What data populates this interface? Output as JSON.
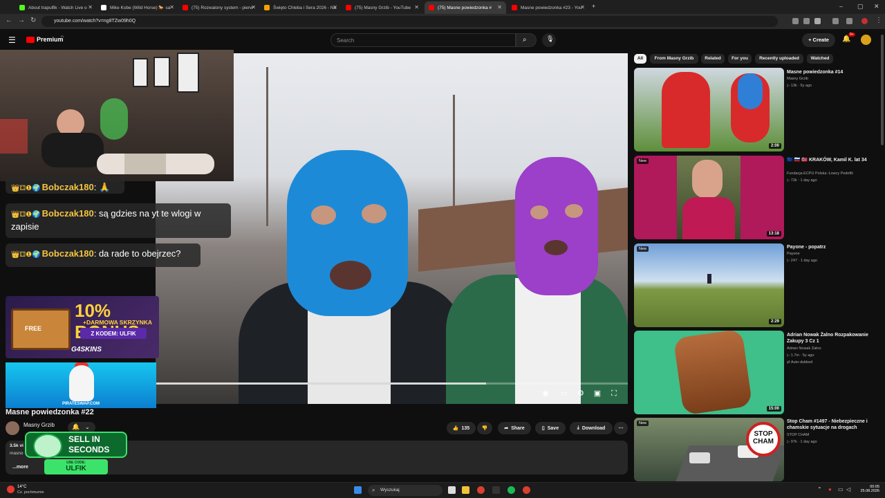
{
  "browser": {
    "tabs": [
      {
        "title": "About trapulfik - Watch Live o",
        "color": "#53fc18"
      },
      {
        "title": "Mike Kobe (Wild Horse) 🐎 sa",
        "color": "#ffffff"
      },
      {
        "title": "(75) Rozwalony system - pierw",
        "color": "#ff0000"
      },
      {
        "title": "Święto Chleba i Sera 2026 - Na",
        "color": "#f4a200"
      },
      {
        "title": "(75) Masny Grzib - YouTube",
        "color": "#ff0000"
      },
      {
        "title": "(75) Masne powiedzonka #",
        "color": "#ff0000"
      },
      {
        "title": "Masne powiedzonka #23 - You",
        "color": "#ff0000"
      }
    ],
    "new_tab": "+",
    "url": "youtube.com/watch?v=ng8TZw09h0Q"
  },
  "youtube": {
    "logo": "Premium",
    "logo_region": "PL",
    "search_placeholder": "Search",
    "create_label": "Create",
    "notif_count": "9+"
  },
  "chat": {
    "messages": [
      {
        "user": "Bobczak180",
        "text": ": 🙏"
      },
      {
        "user": "Bobczak180",
        "text": ": są gdzies na yt te wlogi w zapisie"
      },
      {
        "user": "Bobczak180",
        "text": ": da rade to obejrzec?"
      }
    ],
    "badges": "👑⚃❶🌍"
  },
  "ads": {
    "bonus_big": "10% BONUS",
    "bonus_sub": "+DARMOWA SKRZYNKA",
    "bonus_code": "Z KODEM: ULFIK",
    "bonus_free": "FREE",
    "bonus_brand": "G4SKINS",
    "pirate": "PIRATESWAP.COM",
    "sell_line1": "SELL IN",
    "sell_line2": "SECONDS",
    "sell_use": "USE CODE:",
    "sell_code": "ULFIK"
  },
  "video": {
    "title": "Masne powiedzonka #22",
    "channel": "Masny Grzib",
    "views": "3.5k vi",
    "description": "masno",
    "more": "...more",
    "likes": "135",
    "share": "Share",
    "save": "Save",
    "download": "Download",
    "progress": 0.7
  },
  "sidebar": {
    "chips": [
      "All",
      "From Masny Grzib",
      "Related",
      "For you",
      "Recently uploaded",
      "Watched"
    ],
    "videos": [
      {
        "title": "Masne powiedzonka #14",
        "channel": "Masny Grzib",
        "meta": "▷ 13k · 5y ago",
        "duration": "2:00",
        "new": "",
        "colors": [
          "#d82a2a",
          "#6fa0d6"
        ]
      },
      {
        "title": "🇪🇺 🇷🇺 🇳🇴 KRAKÓW, Kamil K. lat 34",
        "channel": "Fundacja ECPU Polska: Łowcy Pedofili",
        "meta": "▷ 72k · 1 day ago",
        "duration": "13:18",
        "new": "New",
        "colors": [
          "#b0195a",
          "#5a6a3a"
        ]
      },
      {
        "title": "Payone - popatrz",
        "channel": "Payone",
        "meta": "▷ 247 · 1 day ago",
        "duration": "2:29",
        "new": "New",
        "colors": [
          "#8fb0d6",
          "#6f8a3e"
        ]
      },
      {
        "title": "Adrian Nowak Żalno Rozpakowanie Zakupy 3 Cz 1",
        "channel": "Adrian Nowak Żalno",
        "meta": "▷ 1.7m · 5y ago",
        "extra": "⇄ Auto-dubbed",
        "duration": "15:00",
        "new": "",
        "colors": [
          "#3fbf8a",
          "#a0603a"
        ]
      },
      {
        "title": "Stop Cham #1497 - Niebezpieczne i chamskie sytuacje na drogach",
        "channel": "STOP CHAM",
        "meta": "▷ 97k · 1 day ago",
        "duration": "",
        "new": "New",
        "colors": [
          "#7a8a6a",
          "#3a4a3a"
        ]
      }
    ],
    "stop_sign": "STOP CHAM"
  },
  "taskbar": {
    "temp": "14°C",
    "weather": "Cz. pochmurnie",
    "search": "Wyszukaj",
    "time": "00:05",
    "date": "25.08.2026"
  }
}
